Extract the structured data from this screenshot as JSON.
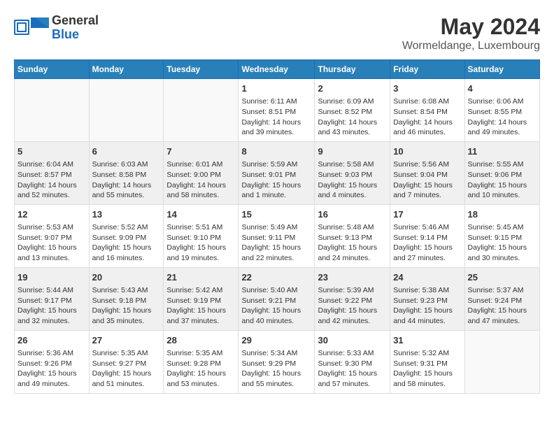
{
  "header": {
    "logo_general": "General",
    "logo_blue": "Blue",
    "month": "May 2024",
    "location": "Wormeldange, Luxembourg"
  },
  "weekdays": [
    "Sunday",
    "Monday",
    "Tuesday",
    "Wednesday",
    "Thursday",
    "Friday",
    "Saturday"
  ],
  "weeks": [
    [
      {
        "day": "",
        "info": ""
      },
      {
        "day": "",
        "info": ""
      },
      {
        "day": "",
        "info": ""
      },
      {
        "day": "1",
        "info": "Sunrise: 6:11 AM\nSunset: 8:51 PM\nDaylight: 14 hours\nand 39 minutes."
      },
      {
        "day": "2",
        "info": "Sunrise: 6:09 AM\nSunset: 8:52 PM\nDaylight: 14 hours\nand 43 minutes."
      },
      {
        "day": "3",
        "info": "Sunrise: 6:08 AM\nSunset: 8:54 PM\nDaylight: 14 hours\nand 46 minutes."
      },
      {
        "day": "4",
        "info": "Sunrise: 6:06 AM\nSunset: 8:55 PM\nDaylight: 14 hours\nand 49 minutes."
      }
    ],
    [
      {
        "day": "5",
        "info": "Sunrise: 6:04 AM\nSunset: 8:57 PM\nDaylight: 14 hours\nand 52 minutes."
      },
      {
        "day": "6",
        "info": "Sunrise: 6:03 AM\nSunset: 8:58 PM\nDaylight: 14 hours\nand 55 minutes."
      },
      {
        "day": "7",
        "info": "Sunrise: 6:01 AM\nSunset: 9:00 PM\nDaylight: 14 hours\nand 58 minutes."
      },
      {
        "day": "8",
        "info": "Sunrise: 5:59 AM\nSunset: 9:01 PM\nDaylight: 15 hours\nand 1 minute."
      },
      {
        "day": "9",
        "info": "Sunrise: 5:58 AM\nSunset: 9:03 PM\nDaylight: 15 hours\nand 4 minutes."
      },
      {
        "day": "10",
        "info": "Sunrise: 5:56 AM\nSunset: 9:04 PM\nDaylight: 15 hours\nand 7 minutes."
      },
      {
        "day": "11",
        "info": "Sunrise: 5:55 AM\nSunset: 9:06 PM\nDaylight: 15 hours\nand 10 minutes."
      }
    ],
    [
      {
        "day": "12",
        "info": "Sunrise: 5:53 AM\nSunset: 9:07 PM\nDaylight: 15 hours\nand 13 minutes."
      },
      {
        "day": "13",
        "info": "Sunrise: 5:52 AM\nSunset: 9:09 PM\nDaylight: 15 hours\nand 16 minutes."
      },
      {
        "day": "14",
        "info": "Sunrise: 5:51 AM\nSunset: 9:10 PM\nDaylight: 15 hours\nand 19 minutes."
      },
      {
        "day": "15",
        "info": "Sunrise: 5:49 AM\nSunset: 9:11 PM\nDaylight: 15 hours\nand 22 minutes."
      },
      {
        "day": "16",
        "info": "Sunrise: 5:48 AM\nSunset: 9:13 PM\nDaylight: 15 hours\nand 24 minutes."
      },
      {
        "day": "17",
        "info": "Sunrise: 5:46 AM\nSunset: 9:14 PM\nDaylight: 15 hours\nand 27 minutes."
      },
      {
        "day": "18",
        "info": "Sunrise: 5:45 AM\nSunset: 9:15 PM\nDaylight: 15 hours\nand 30 minutes."
      }
    ],
    [
      {
        "day": "19",
        "info": "Sunrise: 5:44 AM\nSunset: 9:17 PM\nDaylight: 15 hours\nand 32 minutes."
      },
      {
        "day": "20",
        "info": "Sunrise: 5:43 AM\nSunset: 9:18 PM\nDaylight: 15 hours\nand 35 minutes."
      },
      {
        "day": "21",
        "info": "Sunrise: 5:42 AM\nSunset: 9:19 PM\nDaylight: 15 hours\nand 37 minutes."
      },
      {
        "day": "22",
        "info": "Sunrise: 5:40 AM\nSunset: 9:21 PM\nDaylight: 15 hours\nand 40 minutes."
      },
      {
        "day": "23",
        "info": "Sunrise: 5:39 AM\nSunset: 9:22 PM\nDaylight: 15 hours\nand 42 minutes."
      },
      {
        "day": "24",
        "info": "Sunrise: 5:38 AM\nSunset: 9:23 PM\nDaylight: 15 hours\nand 44 minutes."
      },
      {
        "day": "25",
        "info": "Sunrise: 5:37 AM\nSunset: 9:24 PM\nDaylight: 15 hours\nand 47 minutes."
      }
    ],
    [
      {
        "day": "26",
        "info": "Sunrise: 5:36 AM\nSunset: 9:26 PM\nDaylight: 15 hours\nand 49 minutes."
      },
      {
        "day": "27",
        "info": "Sunrise: 5:35 AM\nSunset: 9:27 PM\nDaylight: 15 hours\nand 51 minutes."
      },
      {
        "day": "28",
        "info": "Sunrise: 5:35 AM\nSunset: 9:28 PM\nDaylight: 15 hours\nand 53 minutes."
      },
      {
        "day": "29",
        "info": "Sunrise: 5:34 AM\nSunset: 9:29 PM\nDaylight: 15 hours\nand 55 minutes."
      },
      {
        "day": "30",
        "info": "Sunrise: 5:33 AM\nSunset: 9:30 PM\nDaylight: 15 hours\nand 57 minutes."
      },
      {
        "day": "31",
        "info": "Sunrise: 5:32 AM\nSunset: 9:31 PM\nDaylight: 15 hours\nand 58 minutes."
      },
      {
        "day": "",
        "info": ""
      }
    ]
  ]
}
